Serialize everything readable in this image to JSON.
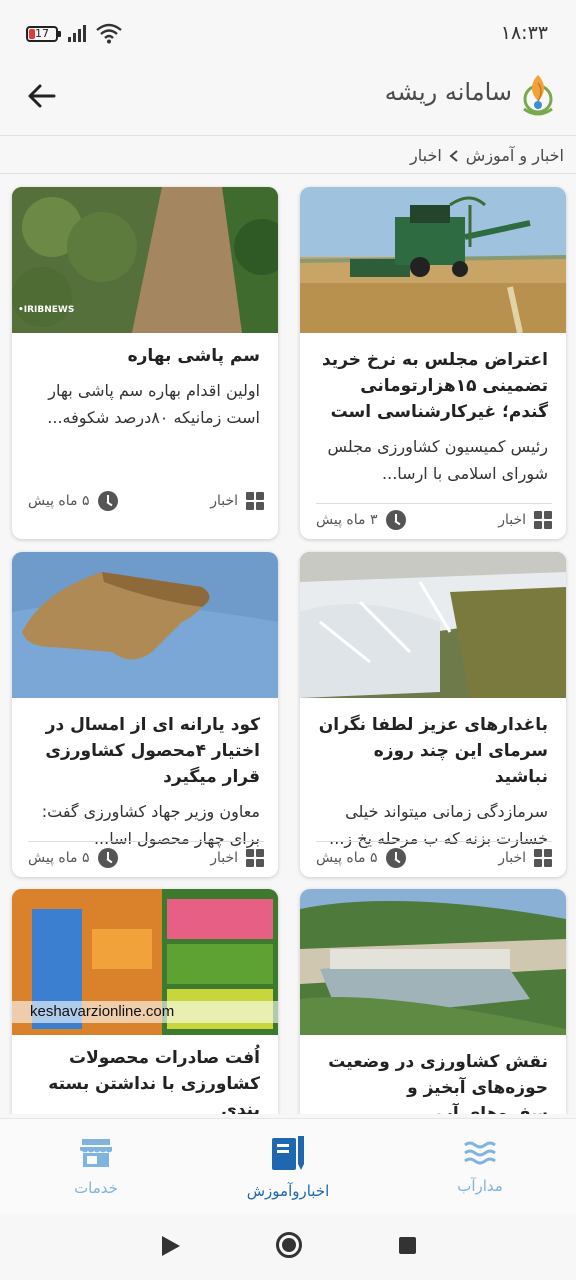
{
  "status_bar": {
    "time": "۱۸:۳۳",
    "battery_level": "17"
  },
  "app_bar": {
    "title": "سامانه ریشه",
    "back_icon": "arrow-left-icon",
    "logo_icon": "rishe-logo-icon"
  },
  "breadcrumb": {
    "items": [
      "اخبار و آموزش",
      "اخبار"
    ],
    "separator_icon": "chevron-left-icon"
  },
  "cards": [
    {
      "image": "harvester-photo",
      "title": "اعتراض مجلس به نرخ خرید تضمینی ۱۵هزارتومانی گندم؛ غیرکارشناسی است",
      "summary": "رئیس کمیسیون کشاورزی مجلس شورای اسلامی با ارسا...",
      "category": "اخبار",
      "time": "۳ ماه پیش"
    },
    {
      "image": "orchard-photo",
      "title": "سم پاشی بهاره",
      "summary": "اولین اقدام بهاره سم پاشی بهار است زمانیکه ۸۰درصد شکوفه...",
      "category": "اخبار",
      "time": "۵ ماه پیش"
    },
    {
      "image": "frozen-orchard-photo",
      "title": "باغدارهای عزیز لطفا نگران سرمای این چند روزه نباشید",
      "summary": "سرمازدگی زمانی میتواند خیلی خسارت بزنه که ب مرحله یخ ز...",
      "category": "اخبار",
      "time": "۵ ماه پیش"
    },
    {
      "image": "fertilizer-sack-photo",
      "title": "کود یارانه ای از امسال در اختیار ۴محصول کشاورزی قرار میگیرد",
      "summary": "معاون وزیر جهاد کشاورزی گفت: برای چهار محصول اسا...",
      "category": "اخبار",
      "time": "۵ ماه پیش"
    },
    {
      "image": "river-watershed-photo",
      "title": "نقش کشاورزی در وضعیت حوزه‌های آبخیز و سفره‌های آب",
      "summary": "",
      "category": "",
      "time": ""
    },
    {
      "image": "produce-market-photo",
      "image_watermark": "keshavarzionline.com",
      "title": "اُفت صادرات محصولات کشاورزی با نداشتن بسته بندی",
      "summary": "",
      "category": "",
      "time": ""
    }
  ],
  "image_overlays": {
    "orchard_watermark": "•IRIBNEWS"
  },
  "bottom_nav": {
    "items": [
      {
        "label": "مدارآب",
        "icon": "water-waves-icon",
        "active": false
      },
      {
        "label": "اخباروآموزش",
        "icon": "news-notebook-icon",
        "active": true
      },
      {
        "label": "خدمات",
        "icon": "store-icon",
        "active": false
      }
    ]
  },
  "colors": {
    "active_nav": "#1f67b0",
    "inactive_nav": "#7fb3e0",
    "battery_low": "#e53935"
  }
}
